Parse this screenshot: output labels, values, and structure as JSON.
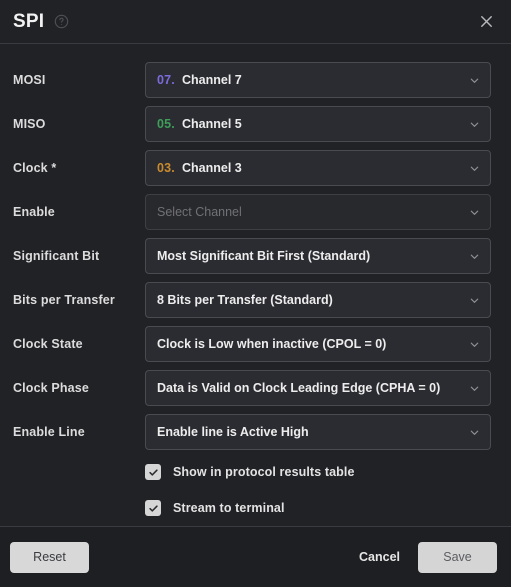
{
  "header": {
    "title": "SPI",
    "help_icon": "help-circle-icon",
    "close_icon": "close-icon"
  },
  "form": {
    "rows": [
      {
        "label": "MOSI",
        "num": "07.",
        "num_color": "#7b6bdb",
        "value": "Channel 7",
        "placeholder": false
      },
      {
        "label": "MISO",
        "num": "05.",
        "num_color": "#3e9e5a",
        "value": "Channel 5",
        "placeholder": false
      },
      {
        "label": "Clock *",
        "num": "03.",
        "num_color": "#c98a2e",
        "value": "Channel 3",
        "placeholder": false
      },
      {
        "label": "Enable",
        "num": "",
        "num_color": "",
        "value": "Select Channel",
        "placeholder": true
      },
      {
        "label": "Significant Bit",
        "num": "",
        "num_color": "",
        "value": "Most Significant Bit First (Standard)",
        "placeholder": false
      },
      {
        "label": "Bits per Transfer",
        "num": "",
        "num_color": "",
        "value": "8 Bits per Transfer (Standard)",
        "placeholder": false
      },
      {
        "label": "Clock State",
        "num": "",
        "num_color": "",
        "value": "Clock is Low when inactive (CPOL = 0)",
        "placeholder": false
      },
      {
        "label": "Clock Phase",
        "num": "",
        "num_color": "",
        "value": "Data is Valid on Clock Leading Edge (CPHA = 0)",
        "placeholder": false
      },
      {
        "label": "Enable Line",
        "num": "",
        "num_color": "",
        "value": "Enable line is Active High",
        "placeholder": false
      }
    ],
    "checkboxes": [
      {
        "label": "Show in protocol results table",
        "checked": true
      },
      {
        "label": "Stream to terminal",
        "checked": true
      }
    ]
  },
  "footer": {
    "reset_label": "Reset",
    "cancel_label": "Cancel",
    "save_label": "Save"
  },
  "colors": {
    "background": "#212226",
    "field": "#2b2c31",
    "field_border": "#4a4b50",
    "divider": "#3a3b40",
    "button_light": "#d8d8d8",
    "channel_7": "#7b6bdb",
    "channel_5": "#3e9e5a",
    "channel_3": "#c98a2e"
  }
}
